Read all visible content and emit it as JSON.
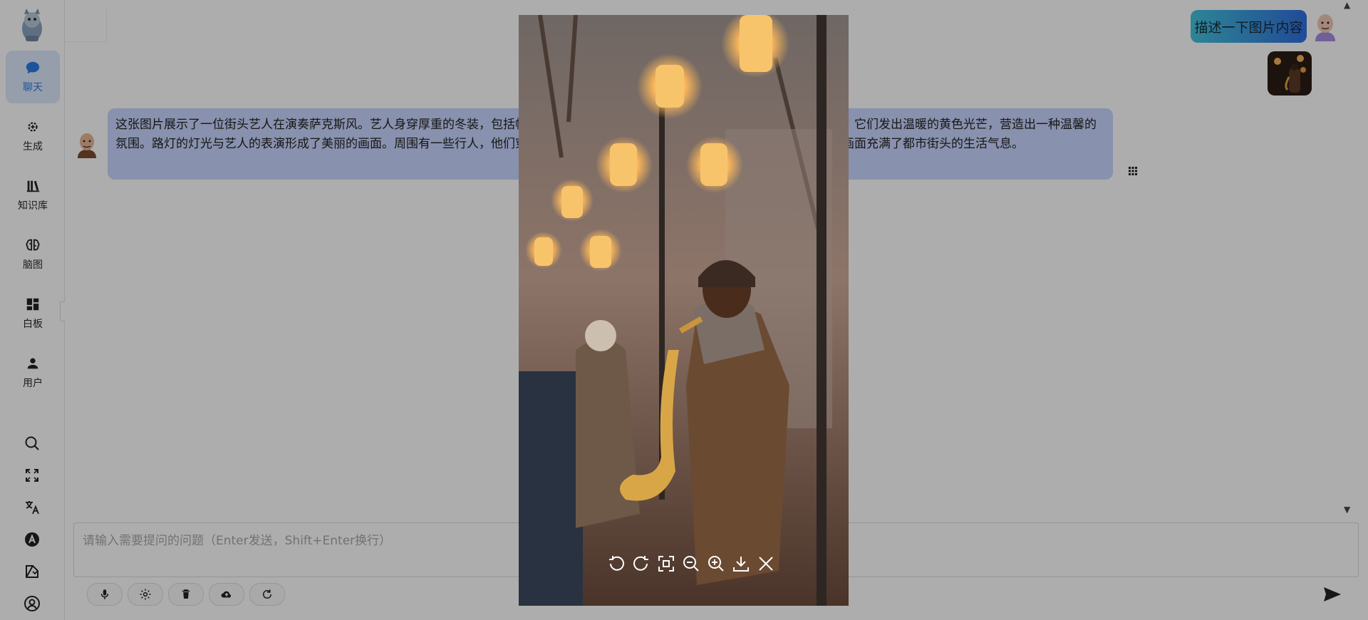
{
  "sidebar": {
    "items": [
      {
        "label": "聊天",
        "icon": "chat-bubble-icon",
        "active": true
      },
      {
        "label": "生成",
        "icon": "sparkle-gear-icon",
        "active": false
      },
      {
        "label": "知识库",
        "icon": "books-icon",
        "active": false
      },
      {
        "label": "脑图",
        "icon": "brain-icon",
        "active": false
      },
      {
        "label": "白板",
        "icon": "dashboard-icon",
        "active": false
      },
      {
        "label": "用户",
        "icon": "person-icon",
        "active": false
      }
    ],
    "tools": [
      "search-icon",
      "fullscreen-icon",
      "translate-icon",
      "letter-a-icon",
      "theme-icon",
      "account-icon"
    ]
  },
  "chat": {
    "user_message": "描述一下图片内容",
    "bot_message": "这张图片展示了一位街头艺人在演奏萨克斯风。艺人身穿厚重的冬装，包括帽子、围巾和外套，正专注地表演。背景中可以看到一些路灯，它们发出温暖的黄色光芒，营造出一种温馨的氛围。路灯的灯光与艺人的表演形成了美丽的画面。周围有一些行人，他们穿着厚实的衣物，似乎在街头漫步或者观看艺人的表演。整体画面充满了都市街头的生活气息。"
  },
  "input": {
    "placeholder": "请输入需要提问的问题（Enter发送，Shift+Enter换行）",
    "value": ""
  },
  "toolbar": [
    "microphone-icon",
    "settings-icon",
    "trash-icon",
    "cloud-upload-icon",
    "refresh-icon"
  ],
  "preview_toolbar": [
    "rotate-left-icon",
    "rotate-right-icon",
    "fit-screen-icon",
    "zoom-out-icon",
    "zoom-in-icon",
    "download-icon",
    "close-icon"
  ],
  "colors": {
    "accent": "#2a7be4",
    "bot_bubble": "#c9d6ff",
    "user_bubble_start": "#45c4dc",
    "user_bubble_end": "#2f6fe0"
  }
}
